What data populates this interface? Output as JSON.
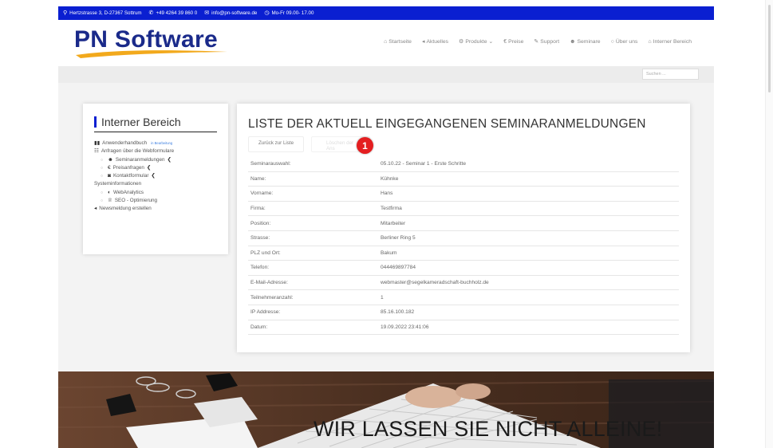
{
  "topbar": {
    "address": "Hertzstrasse 3, D-27367 Sottrum",
    "phone": "+49 4264 39 860 0",
    "email": "info@pn-software.de",
    "hours": "Mo-Fr 09.00- 17.00"
  },
  "header": {
    "logo": "PN Software",
    "nav": [
      "Startseite",
      "Aktuelles",
      "Produkte",
      "Preise",
      "Support",
      "Seminare",
      "Über uns",
      "Interner Bereich"
    ]
  },
  "search": {
    "placeholder": "Suchen ..."
  },
  "sidebar": {
    "title": "Interner Bereich",
    "items": {
      "handbook": "Anwenderhandbuch",
      "handbook_badge": "in Bearbeitung",
      "requests_header": "Anfragen über die Webformulare",
      "seminar": "Seminaranmeldungen",
      "price": "Preisanfragen",
      "contact": "Kontaktformular",
      "sysinfo_header": "Systeminformationen",
      "webanalytics": "WebAnalytics",
      "seo": "SEO - Optimierung",
      "news": "Newsmeldung erstellen"
    }
  },
  "card": {
    "title": "LISTE DER AKTUELL EINGEGANGENEN SEMINARANMELDUNGEN",
    "back_button": "Zurück zur Liste",
    "ghost_button": "Löschen der Ans",
    "marker": "1",
    "rows": [
      {
        "label": "Seminarauswahl:",
        "value": "05.10.22 - Seminar 1 - Erste Schritte"
      },
      {
        "label": "Name:",
        "value": "Kühnke"
      },
      {
        "label": "Vorname:",
        "value": "Hans"
      },
      {
        "label": "Firma:",
        "value": "Testfirma"
      },
      {
        "label": "Position:",
        "value": "Mitarbeiter"
      },
      {
        "label": "Strasse:",
        "value": "Berliner Ring 5"
      },
      {
        "label": "PLZ und Ort:",
        "value": "Bakum"
      },
      {
        "label": "Telefon:",
        "value": "044469897784"
      },
      {
        "label": "E-Mail-Adresse:",
        "value": "webmaster@segelkameradschaft-buchholz.de"
      },
      {
        "label": "Teilnehmeranzahl:",
        "value": "1"
      },
      {
        "label": "IP Addresse:",
        "value": "85.16.100.182"
      },
      {
        "label": "Datum:",
        "value": "19.09.2022 23:41:06"
      }
    ]
  },
  "hero": {
    "text": "WIR LASSEN SIE NICHT ALLEINE!"
  },
  "colors": {
    "brand_blue": "#0a1fd1",
    "marker_red": "#e41e20",
    "logo_blue": "#1a2a8a",
    "swoosh": "#f2a91c"
  }
}
